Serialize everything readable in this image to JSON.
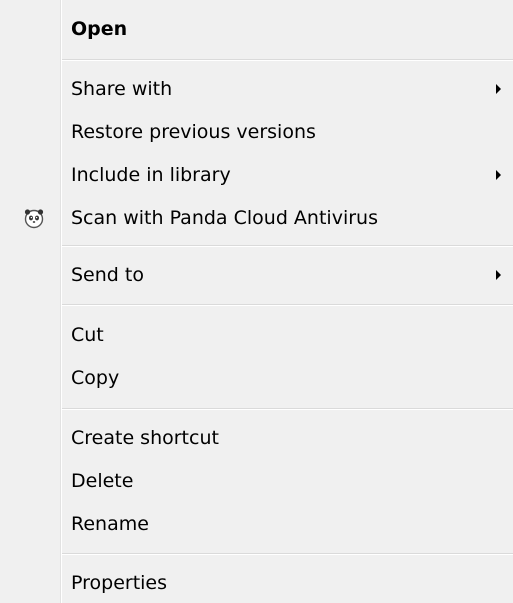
{
  "context_menu": {
    "items": [
      {
        "label": "Open"
      },
      {
        "label": "Share with"
      },
      {
        "label": "Restore previous versions"
      },
      {
        "label": "Include in library"
      },
      {
        "label": "Scan with Panda Cloud Antivirus",
        "icon": "panda-icon"
      },
      {
        "label": "Send to"
      },
      {
        "label": "Cut"
      },
      {
        "label": "Copy"
      },
      {
        "label": "Create shortcut"
      },
      {
        "label": "Delete"
      },
      {
        "label": "Rename"
      },
      {
        "label": "Properties"
      }
    ]
  }
}
